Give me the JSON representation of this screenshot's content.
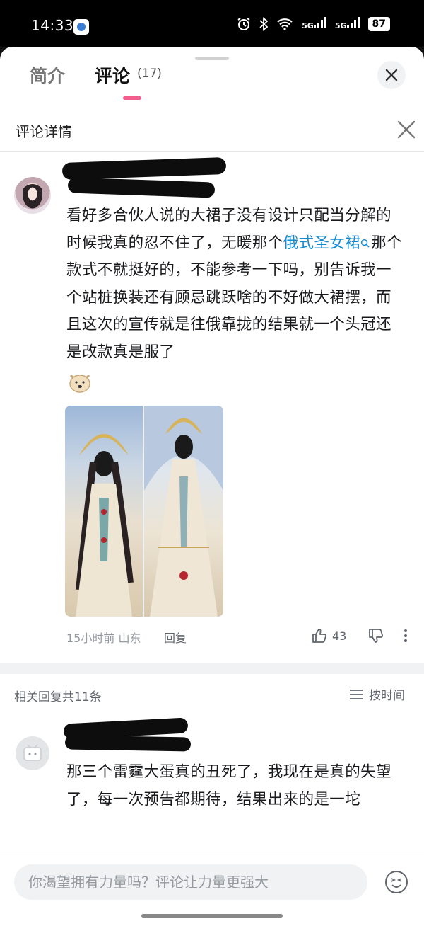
{
  "status_bar": {
    "time": "14:33",
    "signal_1": "5G",
    "signal_2": "5G",
    "battery": "87"
  },
  "tabs": [
    {
      "label": "简介"
    },
    {
      "label": "评论",
      "count": "(17)"
    }
  ],
  "detail": {
    "title": "评论详情"
  },
  "comment": {
    "text_before_link": "看好多合伙人说的大裙子没有设计只配当分解的时候我真的忍不住了，无暖那个",
    "link_text": "俄式圣女裙",
    "text_after_link": "那个款式不就挺好的，不能参考一下吗，别告诉我一个站桩换装还有顾忌跳跃啥的不好做大裙摆，而且这次的宣传就是往俄靠拢的结果就一个头冠还是改款真是服了",
    "time_location": "15小时前 山东",
    "reply_label": "回复",
    "likes": "43"
  },
  "replies": {
    "count_label": "相关回复共11条",
    "sort_label": "按时间",
    "first_reply_text": "那三个雷霆大蛋真的丑死了，我现在是真的失望了，每一次预告都期待，结果出来的是一坨"
  },
  "input": {
    "placeholder": "你渴望拥有力量吗？评论让力量更强大"
  },
  "colors": {
    "accent_pink": "#f25d8e",
    "link_blue": "#178bcf"
  }
}
